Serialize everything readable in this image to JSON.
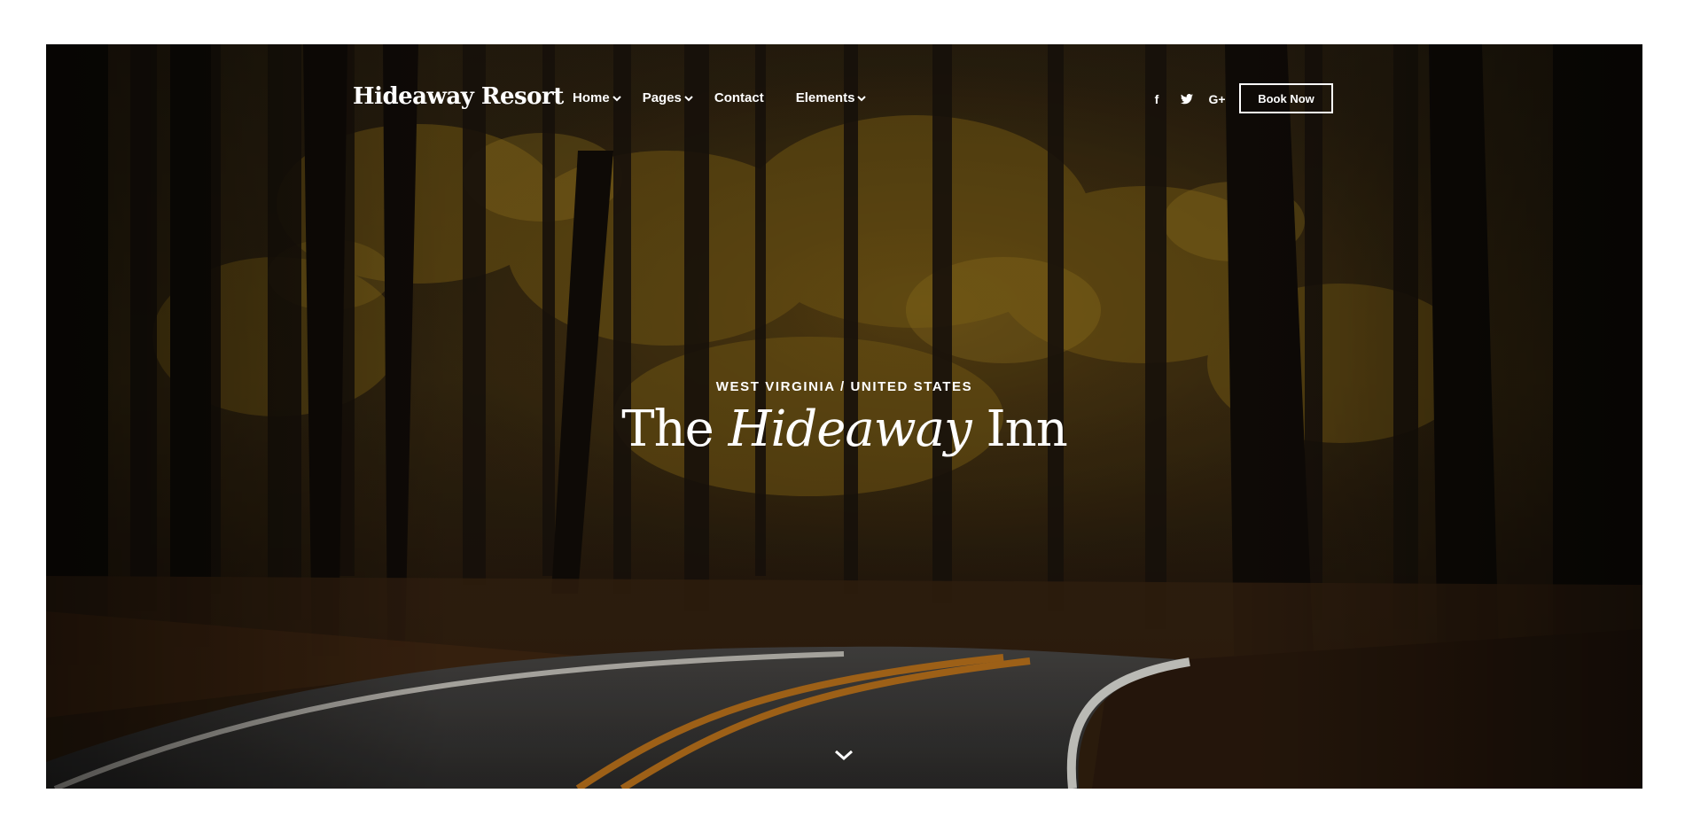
{
  "brand": {
    "name": "Hideaway Resort"
  },
  "nav": {
    "items": [
      {
        "label": "Home",
        "has_dropdown": true
      },
      {
        "label": "Pages",
        "has_dropdown": true
      },
      {
        "label": "Contact",
        "has_dropdown": false
      },
      {
        "label": "Elements",
        "has_dropdown": true
      }
    ]
  },
  "social": {
    "facebook": "f",
    "twitter": "t",
    "google_plus": "G+"
  },
  "cta": {
    "book_label": "Book Now"
  },
  "hero": {
    "kicker": "WEST VIRGINIA / UNITED STATES",
    "title_pre": "The",
    "title_em": "Hideaway",
    "title_post": "Inn",
    "background": "forest-road-photo"
  },
  "icons": {
    "scroll": "chevron-down-icon"
  },
  "colors": {
    "page_bg": "#ffffff",
    "text": "#ffffff",
    "road_line": "#c77a1e",
    "foliage": "#8a6a18"
  }
}
